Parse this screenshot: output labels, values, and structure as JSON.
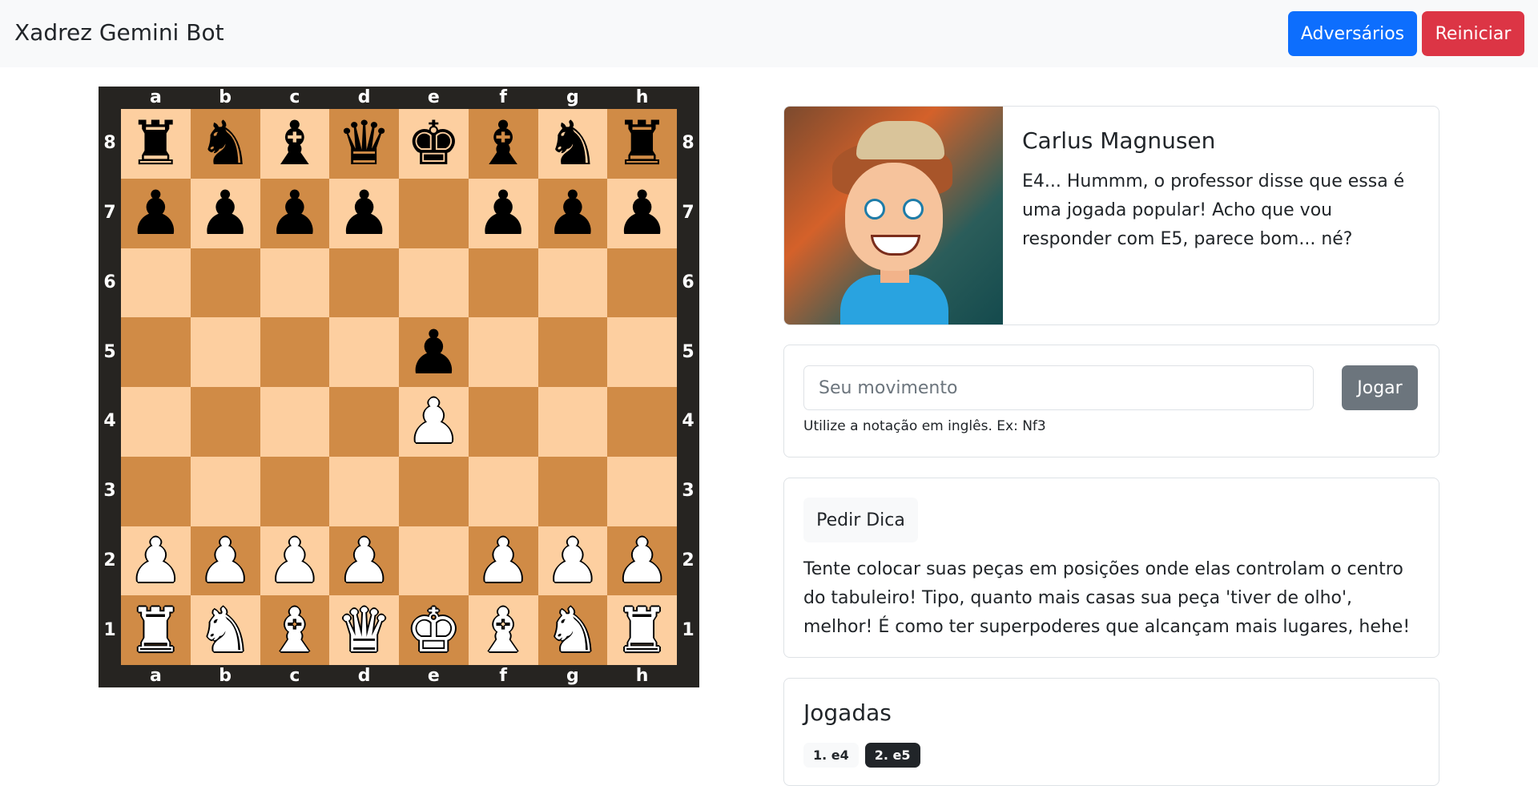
{
  "header": {
    "title": "Xadrez Gemini Bot",
    "opponents_label": "Adversários",
    "restart_label": "Reiniciar"
  },
  "board": {
    "files": [
      "a",
      "b",
      "c",
      "d",
      "e",
      "f",
      "g",
      "h"
    ],
    "ranks": [
      "8",
      "7",
      "6",
      "5",
      "4",
      "3",
      "2",
      "1"
    ],
    "colors": {
      "light": "#fdcfa0",
      "dark": "#d08b46",
      "frame": "#262421"
    },
    "position": [
      [
        "br",
        "bn",
        "bb",
        "bq",
        "bk",
        "bb",
        "bn",
        "br"
      ],
      [
        "bp",
        "bp",
        "bp",
        "bp",
        "",
        "bp",
        "bp",
        "bp"
      ],
      [
        "",
        "",
        "",
        "",
        "",
        "",
        "",
        ""
      ],
      [
        "",
        "",
        "",
        "",
        "bp",
        "",
        "",
        ""
      ],
      [
        "",
        "",
        "",
        "",
        "wp",
        "",
        "",
        ""
      ],
      [
        "",
        "",
        "",
        "",
        "",
        "",
        "",
        ""
      ],
      [
        "wp",
        "wp",
        "wp",
        "wp",
        "",
        "wp",
        "wp",
        "wp"
      ],
      [
        "wr",
        "wn",
        "wb",
        "wq",
        "wk",
        "wb",
        "wn",
        "wr"
      ]
    ]
  },
  "opponent": {
    "name": "Carlus Magnusen",
    "message": "E4... Hummm, o professor disse que essa é uma jogada popular! Acho que vou responder com E5, parece bom... né?"
  },
  "move_form": {
    "placeholder": "Seu movimento",
    "play_label": "Jogar",
    "help": "Utilize a notação em inglês. Ex: Nf3"
  },
  "hint": {
    "button_label": "Pedir Dica",
    "text": "Tente colocar suas peças em posições onde elas controlam o centro do tabuleiro! Tipo, quanto mais casas sua peça 'tiver de olho', melhor! É como ter superpoderes que alcançam mais lugares, hehe!"
  },
  "history": {
    "title": "Jogadas",
    "moves": [
      "1. e4",
      "2. e5"
    ]
  },
  "colors": {
    "primary": "#0d6efd",
    "danger": "#dc3545",
    "secondary": "#6c757d"
  }
}
